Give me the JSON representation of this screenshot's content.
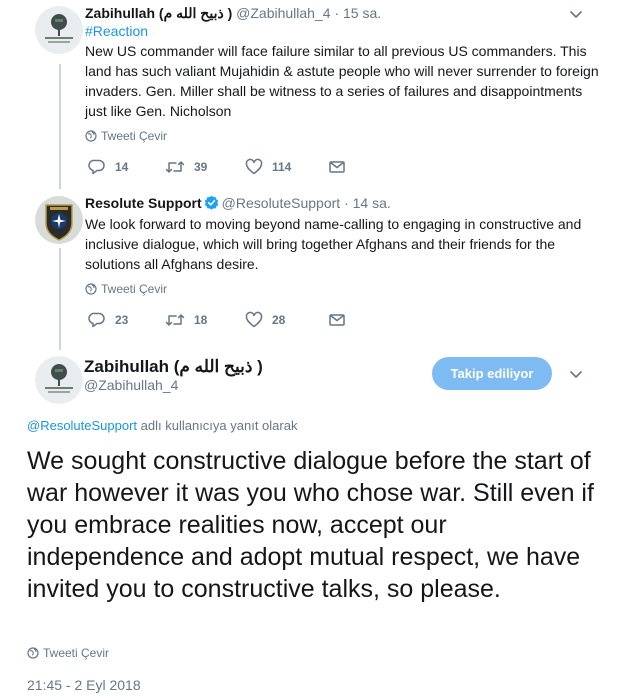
{
  "tweets": [
    {
      "name": "Zabihullah (ذبیح الله م )",
      "handle": "@Zabihullah_4",
      "dot": "·",
      "time": "15 sa.",
      "hashtag": "#Reaction",
      "text": "New US commander will face failure similar to all previous US commanders. This land has such valiant Mujahidin & astute people who will never surrender to foreign invaders. Gen. Miller shall be witness to a series of failures and disappointments just like Gen. Nicholson",
      "translate": "Tweeti Çevir",
      "replies": "14",
      "retweets": "39",
      "likes": "114"
    },
    {
      "name": "Resolute Support",
      "handle": "@ResoluteSupport",
      "dot": "·",
      "time": "14 sa.",
      "text": "We look forward to moving beyond name-calling to engaging in constructive and inclusive dialogue, which will bring together Afghans and their friends for the solutions all Afghans desire.",
      "translate": "Tweeti Çevir",
      "replies": "23",
      "retweets": "18",
      "likes": "28"
    }
  ],
  "main": {
    "name": "Zabihullah (ذبیح الله م )",
    "handle": "@Zabihullah_4",
    "follow_label": "Takip ediliyor",
    "reply_mention": "@ResoluteSupport",
    "reply_suffix": " adlı kullanıcıya yanıt olarak",
    "text": "We sought constructive dialogue before the start of war however it was you who chose war. Still even if you embrace realities now, accept our independence and adopt mutual respect, we have invited you to constructive talks, so please.",
    "translate": "Tweeti Çevir",
    "timestamp": "21:45 - 2 Eyl 2018"
  },
  "colors": {
    "link": "#1b95e0",
    "muted": "#657786",
    "follow_button": "#7fbbf3",
    "thread_line": "#ccd6dd",
    "verified": "#1da1f2"
  },
  "icons": [
    "reply-icon",
    "retweet-icon",
    "like-icon",
    "message-icon",
    "globe-icon",
    "chevron-down-icon",
    "verified-badge-icon"
  ]
}
